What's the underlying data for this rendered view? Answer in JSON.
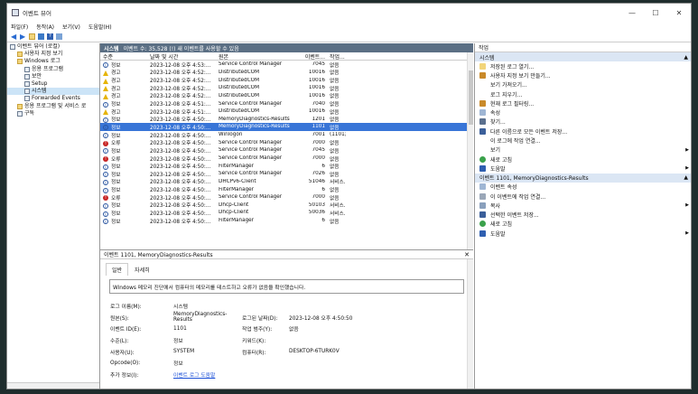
{
  "window": {
    "title": "이벤트 뷰어",
    "controls": [
      "—",
      "☐",
      "✕"
    ]
  },
  "menu": [
    "파일(F)",
    "동작(A)",
    "보기(V)",
    "도움말(H)"
  ],
  "tree": [
    {
      "label": "이벤트 뷰어 (로컬)",
      "indent": 0,
      "type": "root"
    },
    {
      "label": "사용자 지정 보기",
      "indent": 1,
      "type": "folder"
    },
    {
      "label": "Windows 로그",
      "indent": 1,
      "type": "folder"
    },
    {
      "label": "응용 프로그램",
      "indent": 2,
      "type": "log"
    },
    {
      "label": "보안",
      "indent": 2,
      "type": "log"
    },
    {
      "label": "Setup",
      "indent": 2,
      "type": "log"
    },
    {
      "label": "시스템",
      "indent": 2,
      "type": "log",
      "selected": true
    },
    {
      "label": "Forwarded Events",
      "indent": 2,
      "type": "log"
    },
    {
      "label": "응용 프로그램 및 서비스 로",
      "indent": 1,
      "type": "folder"
    },
    {
      "label": "구독",
      "indent": 1,
      "type": "log"
    }
  ],
  "center": {
    "title": "시스템",
    "count_text": "이벤트 수: 35,528 (!) 새 이벤트를 사용할 수 있음"
  },
  "columns": [
    "수준",
    "날짜 및 시간",
    "원본",
    "이벤트...",
    "작업..."
  ],
  "rows": [
    {
      "lvl": "info",
      "level": "정보",
      "dt": "2023-12-08 오후 4:53:...",
      "src": "Service Control Manager",
      "id": "7045",
      "task": "없음"
    },
    {
      "lvl": "warn",
      "level": "경고",
      "dt": "2023-12-08 오후 4:52:...",
      "src": "DistributedCOM",
      "id": "10016",
      "task": "없음"
    },
    {
      "lvl": "warn",
      "level": "경고",
      "dt": "2023-12-08 오후 4:52:...",
      "src": "DistributedCOM",
      "id": "10016",
      "task": "없음"
    },
    {
      "lvl": "warn",
      "level": "경고",
      "dt": "2023-12-08 오후 4:52:...",
      "src": "DistributedCOM",
      "id": "10016",
      "task": "없음"
    },
    {
      "lvl": "warn",
      "level": "경고",
      "dt": "2023-12-08 오후 4:52:...",
      "src": "DistributedCOM",
      "id": "10016",
      "task": "없음"
    },
    {
      "lvl": "info",
      "level": "정보",
      "dt": "2023-12-08 오후 4:51:...",
      "src": "Service Control Manager",
      "id": "7040",
      "task": "없음"
    },
    {
      "lvl": "warn",
      "level": "경고",
      "dt": "2023-12-08 오후 4:51:...",
      "src": "DistributedCOM",
      "id": "10016",
      "task": "없음"
    },
    {
      "lvl": "info",
      "level": "정보",
      "dt": "2023-12-08 오후 4:50:...",
      "src": "MemoryDiagnostics-Results",
      "id": "1201",
      "task": "없음"
    },
    {
      "lvl": "info",
      "level": "정보",
      "dt": "2023-12-08 오후 4:50:...",
      "src": "MemoryDiagnostics-Results",
      "id": "1101",
      "task": "없음",
      "selected": true
    },
    {
      "lvl": "info",
      "level": "정보",
      "dt": "2023-12-08 오후 4:50:...",
      "src": "Winlogon",
      "id": "7001",
      "task": "(1101)"
    },
    {
      "lvl": "err",
      "level": "오류",
      "dt": "2023-12-08 오후 4:50:...",
      "src": "Service Control Manager",
      "id": "7000",
      "task": "없음"
    },
    {
      "lvl": "info",
      "level": "정보",
      "dt": "2023-12-08 오후 4:50:...",
      "src": "Service Control Manager",
      "id": "7045",
      "task": "없음"
    },
    {
      "lvl": "err",
      "level": "오류",
      "dt": "2023-12-08 오후 4:50:...",
      "src": "Service Control Manager",
      "id": "7000",
      "task": "없음"
    },
    {
      "lvl": "info",
      "level": "정보",
      "dt": "2023-12-08 오후 4:50:...",
      "src": "FilterManager",
      "id": "6",
      "task": "없음"
    },
    {
      "lvl": "info",
      "level": "정보",
      "dt": "2023-12-08 오후 4:50:...",
      "src": "Service Control Manager",
      "id": "7026",
      "task": "없음"
    },
    {
      "lvl": "info",
      "level": "정보",
      "dt": "2023-12-08 오후 4:50:...",
      "src": "DHCPv6-Client",
      "id": "51046",
      "task": "서비스..."
    },
    {
      "lvl": "info",
      "level": "정보",
      "dt": "2023-12-08 오후 4:50:...",
      "src": "FilterManager",
      "id": "6",
      "task": "없음"
    },
    {
      "lvl": "err",
      "level": "오류",
      "dt": "2023-12-08 오후 4:50:...",
      "src": "Service Control Manager",
      "id": "7000",
      "task": "없음"
    },
    {
      "lvl": "info",
      "level": "정보",
      "dt": "2023-12-08 오후 4:50:...",
      "src": "Dhcp-Client",
      "id": "50103",
      "task": "서비스..."
    },
    {
      "lvl": "info",
      "level": "정보",
      "dt": "2023-12-08 오후 4:50:...",
      "src": "Dhcp-Client",
      "id": "50036",
      "task": "서비스..."
    },
    {
      "lvl": "info",
      "level": "정보",
      "dt": "2023-12-08 오후 4:50:...",
      "src": "FilterManager",
      "id": "6",
      "task": "없음"
    }
  ],
  "detail": {
    "title": "이벤트 1101, MemoryDiagnostics-Results",
    "tabs": [
      "일반",
      "자세히"
    ],
    "message": "Windows 메모리 진단에서 컴퓨터의 메모리를 테스트하고 오류가 없음을 확인했습니다.",
    "log_name_k": "로그 이름(M):",
    "log_name_v": "시스템",
    "source_k": "원본(S):",
    "source_v": "MemoryDiagnostics-Results",
    "logged_k": "로그된 날짜(D):",
    "logged_v": "2023-12-08 오후 4:50:50",
    "eventid_k": "이벤트 ID(E):",
    "eventid_v": "1101",
    "task_k": "작업 범주(Y):",
    "task_v": "없음",
    "level_k": "수준(L):",
    "level_v": "정보",
    "keywords_k": "키워드(K):",
    "keywords_v": "",
    "user_k": "사용자(U):",
    "user_v": "SYSTEM",
    "computer_k": "컴퓨터(R):",
    "computer_v": "DESKTOP-6TURK0V",
    "opcode_k": "Opcode(O):",
    "opcode_v": "정보",
    "more_k": "추가 정보(I):",
    "more_v": "이벤트 로그 도움말"
  },
  "actions": {
    "title": "작업",
    "sec1": "시스템",
    "items1": [
      {
        "label": "저장된 로그 열기...",
        "icon": "folder-open-icon"
      },
      {
        "label": "사용자 지정 보기 만들기...",
        "icon": "filter-icon"
      },
      {
        "label": "보기 가져오기...",
        "icon": ""
      },
      {
        "label": "로그 지우기...",
        "icon": ""
      },
      {
        "label": "현재 로그 필터링...",
        "icon": "filter-icon"
      },
      {
        "label": "속성",
        "icon": "properties-icon"
      },
      {
        "label": "찾기...",
        "icon": "find-icon"
      },
      {
        "label": "다른 이름으로 모든 이벤트 저장...",
        "icon": "save-icon"
      },
      {
        "label": "이 로그에 작업 연결...",
        "icon": ""
      },
      {
        "label": "보기",
        "icon": "",
        "sub": true
      },
      {
        "label": "새로 고침",
        "icon": "refresh-icon"
      },
      {
        "label": "도움말",
        "icon": "help-icon",
        "sub": true
      }
    ],
    "sec2": "이벤트 1101, MemoryDiagnostics-Results",
    "items2": [
      {
        "label": "이벤트 속성",
        "icon": "properties-icon"
      },
      {
        "label": "이 이벤트에 작업 연결...",
        "icon": "task-icon"
      },
      {
        "label": "복사",
        "icon": "copy-icon",
        "sub": true
      },
      {
        "label": "선택한 이벤트 저장...",
        "icon": "save-icon"
      },
      {
        "label": "새로 고침",
        "icon": "refresh-icon"
      },
      {
        "label": "도움말",
        "icon": "help-icon",
        "sub": true
      }
    ]
  },
  "colors": {
    "header_bg": "#5b6f84",
    "selected_row": "#3875d7",
    "section_bg": "#dbe6f4",
    "desktop": "#1f2d2d"
  }
}
